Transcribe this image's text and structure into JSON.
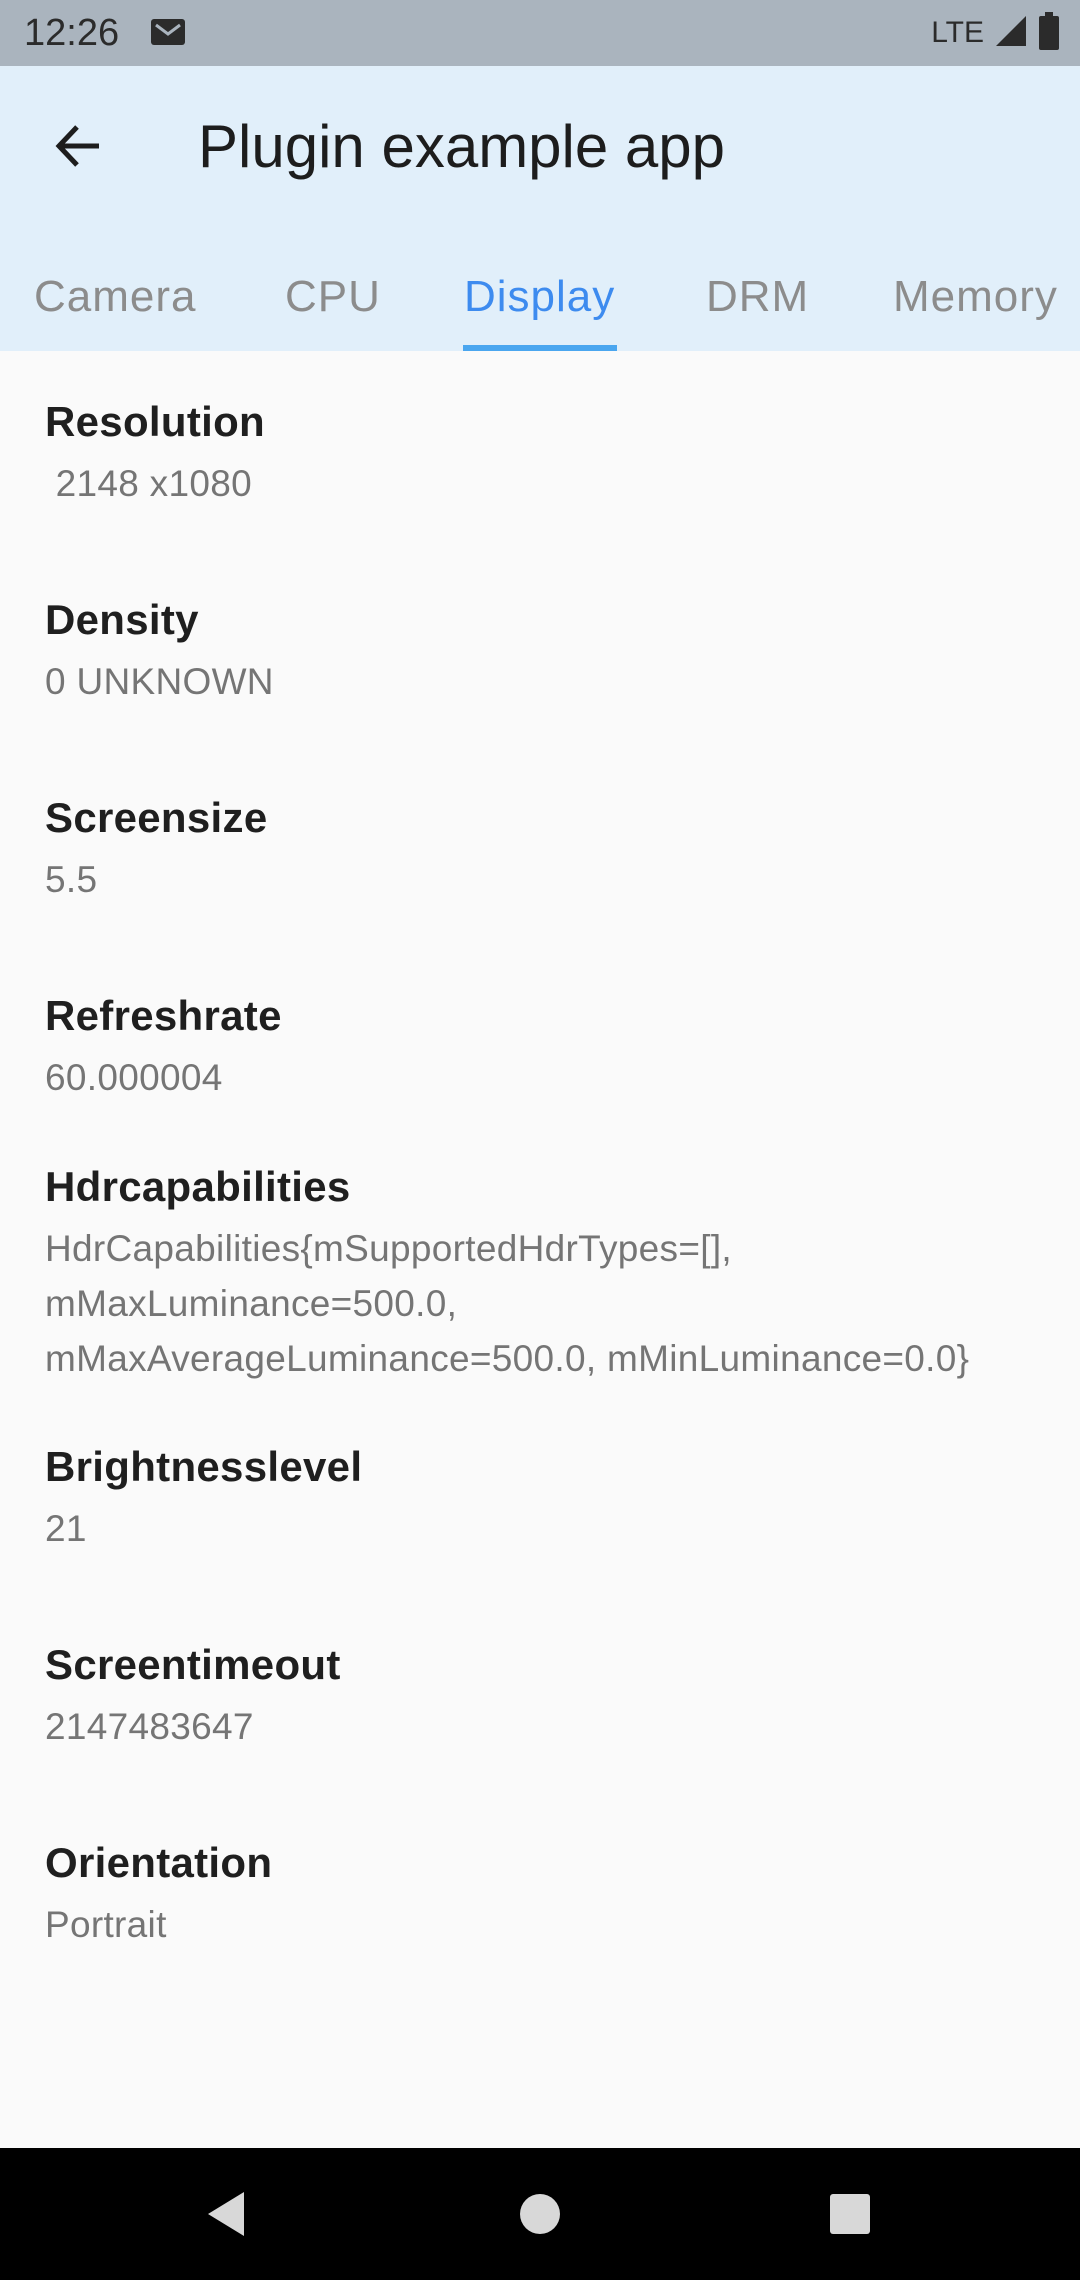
{
  "status_bar": {
    "time": "12:26",
    "network": "LTE",
    "icons": [
      "mail-icon",
      "signal-icon",
      "battery-icon"
    ]
  },
  "app_bar": {
    "title": "Plugin example app",
    "back_icon": "arrow-back-icon"
  },
  "tabs": [
    {
      "label": "Camera",
      "active": false
    },
    {
      "label": "CPU",
      "active": false
    },
    {
      "label": "Display",
      "active": true
    },
    {
      "label": "DRM",
      "active": false
    },
    {
      "label": "Memory",
      "active": false
    }
  ],
  "items": [
    {
      "label": "Resolution",
      "value": " 2148 x1080"
    },
    {
      "label": "Density",
      "value": "0 UNKNOWN"
    },
    {
      "label": "Screensize",
      "value": "5.5"
    },
    {
      "label": "Refreshrate",
      "value": "60.000004"
    },
    {
      "label": "Hdrcapabilities",
      "value_lines": [
        "HdrCapabilities{mSupportedHdrTypes=[],",
        "mMaxLuminance=500.0,",
        "mMaxAverageLuminance=500.0, mMinLuminance=0.0}"
      ]
    },
    {
      "label": "Brightnesslevel",
      "value": "21"
    },
    {
      "label": "Screentimeout",
      "value": "2147483647"
    },
    {
      "label": "Orientation",
      "value": "Portrait"
    }
  ],
  "nav_bar": {
    "icons": [
      "nav-back-icon",
      "nav-home-icon",
      "nav-recents-icon"
    ]
  },
  "colors": {
    "status_bar": "#aab4be",
    "app_bar": "#e1effa",
    "accent": "#3d8bef",
    "indicator": "#4aa6ef",
    "background": "#fafafa"
  }
}
